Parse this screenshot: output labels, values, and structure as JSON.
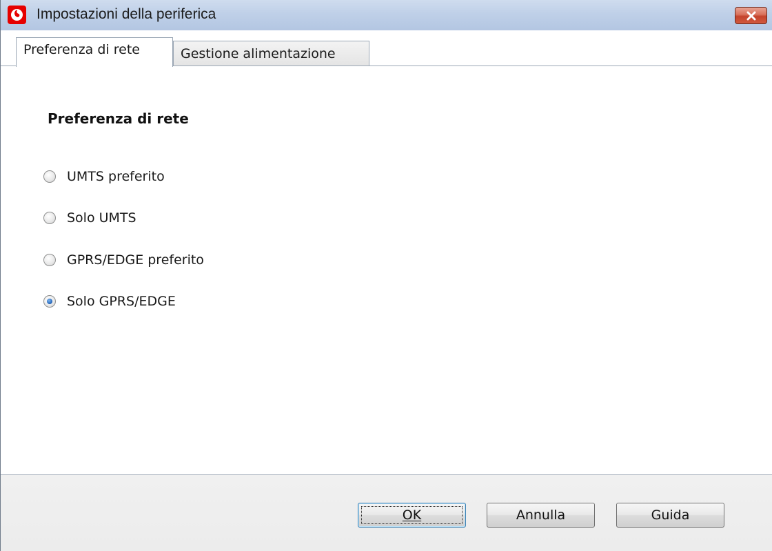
{
  "window": {
    "title": "Impostazioni della periferica",
    "accent_color": "#e60000"
  },
  "tabs": [
    {
      "label": "Preferenza di rete",
      "active": true
    },
    {
      "label": "Gestione alimentazione",
      "active": false
    }
  ],
  "panel": {
    "section_title": "Preferenza di rete",
    "options": [
      {
        "label": "UMTS preferito",
        "selected": false
      },
      {
        "label": "Solo UMTS",
        "selected": false
      },
      {
        "label": "GPRS/EDGE preferito",
        "selected": false
      },
      {
        "label": "Solo GPRS/EDGE",
        "selected": true
      }
    ]
  },
  "buttons": {
    "ok": "OK",
    "cancel": "Annulla",
    "help": "Guida"
  }
}
